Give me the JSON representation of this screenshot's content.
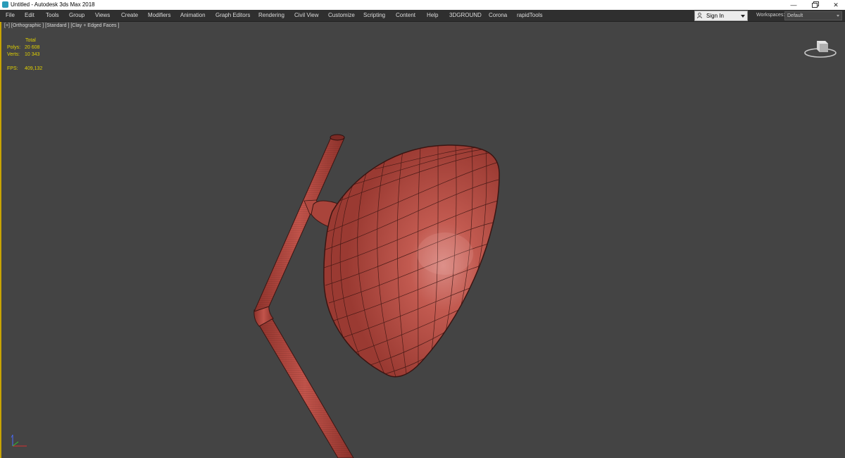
{
  "window": {
    "title": "Untitled - Autodesk 3ds Max 2018",
    "minimize_glyph": "—",
    "close_glyph": "✕"
  },
  "menu": {
    "items": [
      "File",
      "Edit",
      "Tools",
      "Group",
      "Views",
      "Create",
      "Modifiers",
      "Animation",
      "Graph Editors",
      "Rendering",
      "Civil View",
      "Customize",
      "Scripting",
      "Content",
      "Help",
      "3DGROUND",
      "Corona",
      "rapidTools"
    ]
  },
  "account": {
    "sign_in_label": "Sign In",
    "workspaces_label": "Workspaces:",
    "workspace_value": "Default"
  },
  "viewport": {
    "label": "[+] [Orthographic ] [Standard ] [Clay + Edged Faces ]",
    "stats": {
      "header": "Total",
      "polys_label": "Polys:",
      "polys_value": "20 608",
      "verts_label": "Verts:",
      "verts_value": "10 343",
      "fps_label": "FPS:",
      "fps_value": "409,132"
    }
  },
  "colors": {
    "viewport_bg": "#444444",
    "active_border": "#c8a400",
    "stats_text": "#e0d000",
    "model_clay": "#b44a40",
    "model_edges": "#3a1512",
    "menubar_bg": "#2f2f2f"
  },
  "icons": {
    "app": "3dsmax-app-icon",
    "viewcube": "viewcube-icon",
    "user": "user-icon",
    "axis": "axis-tripod-icon"
  }
}
